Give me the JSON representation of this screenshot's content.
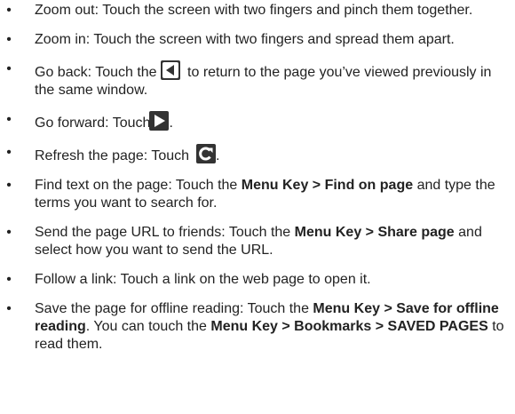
{
  "bullet_glyph": "•",
  "items": [
    {
      "text": "Zoom out: Touch the screen with two fingers and pinch them together."
    },
    {
      "text": "Zoom in: Touch the screen with two fingers and spread them apart."
    },
    {
      "before": "Go back: Touch the",
      "icon": "back-arrow-icon",
      "after": " to return to the page you’ve viewed previously in the same window."
    },
    {
      "before": "Go forward: Touch",
      "icon": "forward-arrow-icon",
      "after": "."
    },
    {
      "before": "Refresh the page: Touch",
      "icon": "refresh-icon",
      "after": "."
    },
    {
      "segments": [
        "Find text on the page: Touch the ",
        "Menu Key > Find on page",
        " and type the terms you want to search for."
      ]
    },
    {
      "segments": [
        "Send the page URL to friends: Touch the ",
        "Menu Key > Share page",
        " and select how you want to send the URL."
      ]
    },
    {
      "text": "Follow a link: Touch a link on the web page to open it."
    },
    {
      "segments": [
        "Save the page for offline reading: Touch the ",
        "Menu Key > Save for offline reading",
        ". You can touch the ",
        "Menu Key > Bookmarks > SAVED PAGES",
        " to read them."
      ]
    }
  ]
}
